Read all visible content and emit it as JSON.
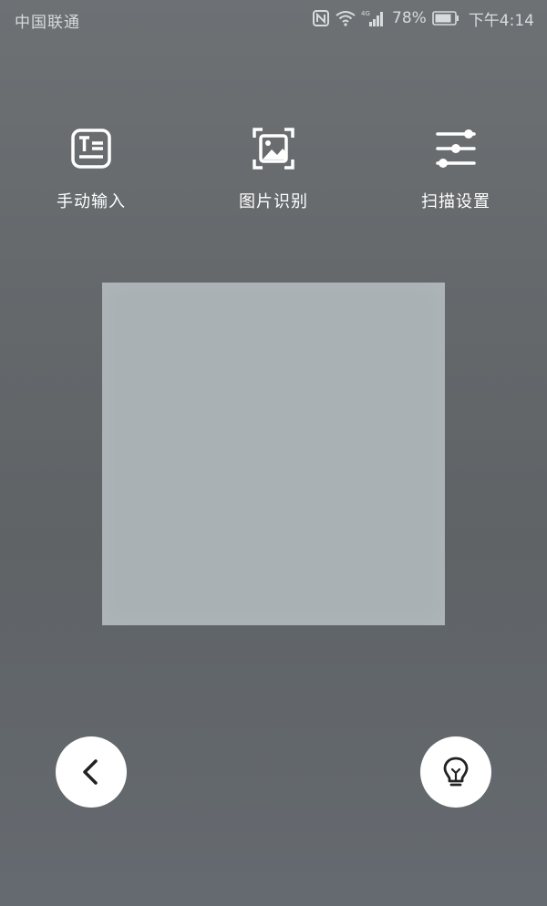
{
  "status_bar": {
    "carrier": "中国联通",
    "network": "4G",
    "battery_percent": "78%",
    "time": "下午4:14",
    "icons": [
      "nfc-icon",
      "wifi-icon",
      "signal-icon",
      "battery-icon"
    ]
  },
  "toolbar": {
    "items": [
      {
        "label": "手动输入",
        "icon": "text-edit-icon"
      },
      {
        "label": "图片识别",
        "icon": "image-scan-icon"
      },
      {
        "label": "扫描设置",
        "icon": "sliders-icon"
      }
    ]
  },
  "bottom": {
    "back_icon": "chevron-left-icon",
    "light_icon": "lightbulb-icon"
  },
  "colors": {
    "background": "#65696c",
    "scan_frame": "#a9b1b5",
    "button_bg": "#ffffff",
    "icon_dark": "#222222"
  }
}
